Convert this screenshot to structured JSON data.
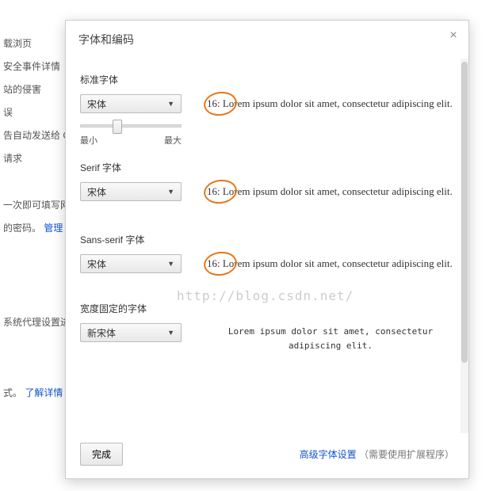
{
  "sidebar": {
    "items": [
      "载浏页",
      "安全事件详情",
      "站的侵害",
      "误",
      "告自动发送给 G",
      "请求",
      "",
      "一次即可填写网",
      "的密码。",
      "",
      "",
      "系统代理设置进",
      "",
      "式。"
    ],
    "link1": "管理",
    "link2": "了解详情"
  },
  "modal": {
    "title": "字体和编码",
    "sections": {
      "standard": {
        "title": "标准字体",
        "selected": "宋体",
        "slider_min": "最小",
        "slider_max": "最大",
        "preview": "16: Lorem ipsum dolor sit amet, consectetur adipiscing elit."
      },
      "serif": {
        "title": "Serif 字体",
        "selected": "宋体",
        "preview": "16: Lorem ipsum dolor sit amet, consectetur adipiscing elit."
      },
      "sans": {
        "title": "Sans-serif 字体",
        "selected": "宋体",
        "preview": "16: Lorem ipsum dolor sit amet, consectetur adipiscing elit."
      },
      "fixed": {
        "title": "宽度固定的字体",
        "selected": "新宋体",
        "preview": "Lorem ipsum dolor sit amet, consectetur adipiscing elit."
      }
    },
    "watermark": "http://blog.csdn.net/",
    "footer": {
      "done": "完成",
      "link": "高级字体设置",
      "note": "（需要使用扩展程序）"
    }
  }
}
